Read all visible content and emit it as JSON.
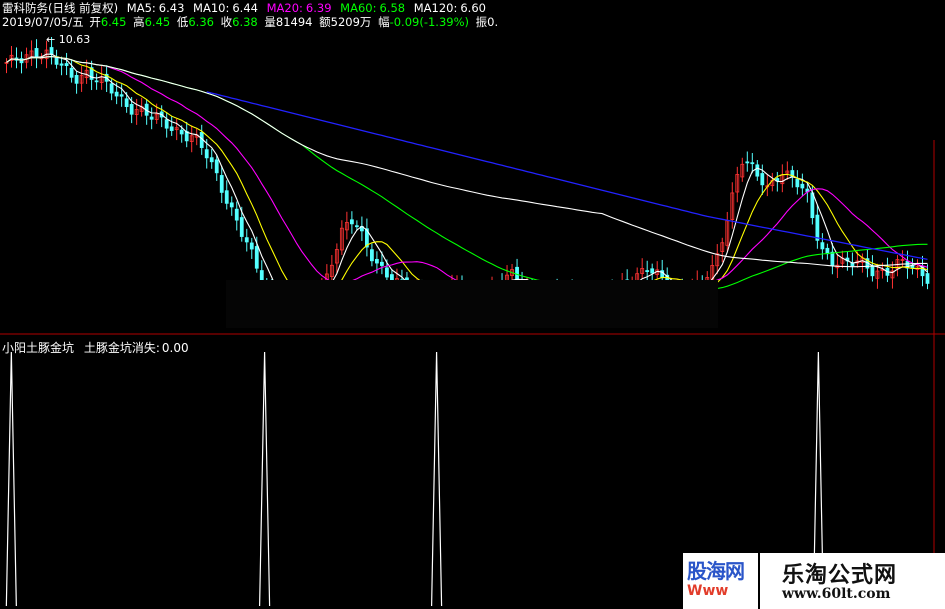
{
  "header": {
    "stock_title": "雷科防务(日线 前复权)",
    "ma_items": [
      {
        "label": "MA5:",
        "value": "6.43",
        "color": "#ffffff"
      },
      {
        "label": "MA10:",
        "value": "6.44",
        "color": "#ffff00"
      },
      {
        "label": "MA20:",
        "value": "6.39",
        "color": "#ff00ff"
      },
      {
        "label": "MA60:",
        "value": "6.58",
        "color": "#00ff00"
      },
      {
        "label": "MA120:",
        "value": "6.60",
        "color": "#ffffff"
      }
    ],
    "date": "2019/07/05/五",
    "open_label": "开",
    "open": "6.45",
    "high_label": "高",
    "high": "6.45",
    "low_label": "低",
    "low": "6.36",
    "close_label": "收",
    "close": "6.38",
    "volume_label": "量",
    "volume": "81494",
    "amount_label": "额",
    "amount": "5209万",
    "change_label": "幅",
    "change": "-0.09(-1.39%)",
    "amplitude_label": "振",
    "amplitude": "0."
  },
  "colors": {
    "up": "#ff3232",
    "down": "#54ffff",
    "ma5": "#ffffff",
    "ma10": "#ffff00",
    "ma20": "#ff00ff",
    "ma60": "#00ff00",
    "ma120": "#ffffff",
    "ma250": "#2222ff",
    "frame": "#b00000",
    "indicator_line": "#ffffff",
    "label_green": "#00ff00"
  },
  "indicator": {
    "name": "小阳土豚金坑",
    "line_label": "土豚金坑消失:",
    "line_value": "0.00"
  },
  "annotation_peak": "10.63",
  "watermarks": {
    "left_big": "股海网",
    "left_small": "Www",
    "right_big": "乐淘公式网",
    "right_small": "www.60lt.com"
  },
  "chart_data": {
    "type": "candlestick",
    "note_peak_price": "10.63",
    "close_estimate": [
      10.3,
      10.45,
      10.6,
      10.5,
      10.3,
      10.1,
      10.2,
      10.0,
      9.8,
      9.6,
      9.5,
      9.3,
      9.2,
      9.1,
      9.0,
      8.6,
      8.1,
      7.6,
      7.0,
      6.3,
      5.9,
      5.8,
      5.8,
      6.0,
      6.4,
      7.2,
      7.4,
      6.9,
      6.6,
      6.3,
      6.1,
      6.0,
      6.0,
      6.1,
      6.1,
      6.0,
      6.1,
      6.2,
      6.4,
      6.2,
      6.1,
      6.0,
      6.0,
      5.9,
      5.9,
      6.0,
      6.2,
      6.4,
      6.5,
      6.3,
      6.1,
      6.1,
      6.2,
      6.5,
      7.5,
      8.6,
      8.3,
      8.0,
      8.4,
      8.2,
      7.8,
      6.9,
      6.7,
      6.6,
      6.6,
      6.5,
      6.5,
      6.6,
      6.5,
      6.4
    ],
    "indicator_signal_x_fraction": [
      0.012,
      0.28,
      0.462,
      0.866
    ],
    "indicator_value": 0.0
  }
}
